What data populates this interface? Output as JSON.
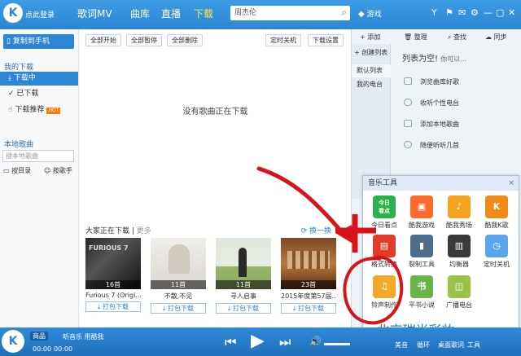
{
  "header": {
    "login": "点此登录",
    "nav": [
      "歌词MV",
      "曲库",
      "直播",
      "下载"
    ],
    "search_value": "周杰伦",
    "game": "游戏"
  },
  "left": {
    "copy_btn": "复制到手机",
    "my_download": "我的下载",
    "items": [
      "下载中",
      "已下载",
      "下载推荐"
    ],
    "hot": "HOT",
    "local": "本地歌曲",
    "search_ph": "搜本地歌曲",
    "by_dir": "按目录",
    "by_singer": "按歌手"
  },
  "main": {
    "buttons": [
      "全部开始",
      "全部暂停",
      "全部删除",
      "定时关机",
      "下载设置"
    ],
    "empty": "没有歌曲正在下载",
    "section": "大家正在下载",
    "more": "更多",
    "swap": "换一换",
    "cards": [
      {
        "count": "16首",
        "title": "Furious 7 (Origi...",
        "dl": "打包下载",
        "cover_text": "FURIOUS 7"
      },
      {
        "count": "11首",
        "title": "不散,不见",
        "dl": "打包下载",
        "cover_text": ""
      },
      {
        "count": "11首",
        "title": "寻人启事",
        "dl": "打包下载",
        "cover_text": ""
      },
      {
        "count": "23首",
        "title": "2015年度第57届...",
        "dl": "打包下载",
        "cover_text": ""
      }
    ]
  },
  "right": {
    "tools": [
      "添加",
      "整理",
      "查找",
      "同步"
    ],
    "create": "+ 创建列表",
    "lists": [
      "默认列表",
      "我的电台"
    ],
    "empty": "列表为空!",
    "empty_hint": "你可以...",
    "options": [
      "浏览曲库好歌",
      "收听个性电台",
      "添加本地歌曲",
      "随便听听几首"
    ]
  },
  "tools": {
    "title": "音乐工具",
    "close": "×",
    "items": [
      {
        "label": "今日看点",
        "icon": "今日\n看点",
        "color": "#2bb04a"
      },
      {
        "label": "酷我游戏",
        "icon": "▣",
        "color": "#ff6a2a"
      },
      {
        "label": "酷我秀场",
        "icon": "♪",
        "color": "#f5a41f"
      },
      {
        "label": "酷我K歌",
        "icon": "K",
        "color": "#f08a1a"
      },
      {
        "label": "格式转换",
        "icon": "▤",
        "color": "#e33b2a"
      },
      {
        "label": "裂制工具",
        "icon": "▮",
        "color": "#4b6d8e"
      },
      {
        "label": "均衡器",
        "icon": "▥",
        "color": "#3a3a3a"
      },
      {
        "label": "定时关机",
        "icon": "◷",
        "color": "#5aa6e8"
      },
      {
        "label": "铃声制作",
        "icon": "♫",
        "color": "#f2a92a"
      },
      {
        "label": "平书小说",
        "icon": "书",
        "color": "#6bb44a"
      },
      {
        "label": "广播电台",
        "icon": "◫",
        "color": "#9ac24a"
      }
    ]
  },
  "player": {
    "badge": "商品",
    "song": "听音乐 用酷我",
    "time1": "00:00",
    "time2": "00:00",
    "beauty": "美音",
    "loop": "循环",
    "lyric": "桌面歌词",
    "tools": "工具"
  },
  "watermark": "北京瑞尚彩妆"
}
